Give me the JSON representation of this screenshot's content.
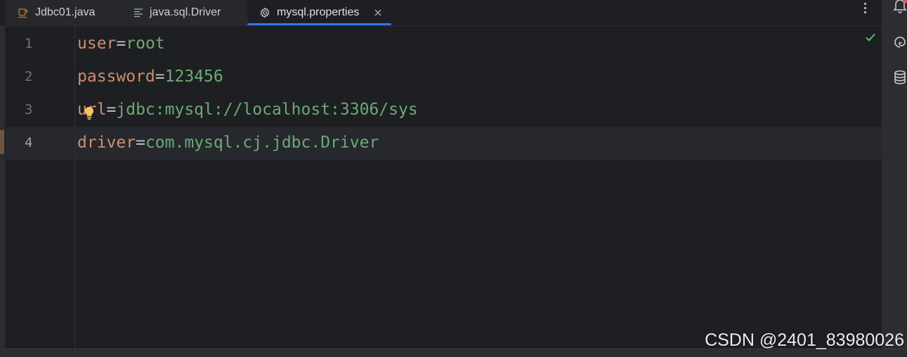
{
  "tabs": [
    {
      "label": "Jdbc01.java",
      "icon": "java-class-icon"
    },
    {
      "label": "java.sql.Driver",
      "icon": "text-file-icon"
    },
    {
      "label": "mysql.properties",
      "icon": "gear-icon",
      "active": true,
      "close_icon": "close-icon"
    }
  ],
  "toolbar": {
    "more_icon": "more-options-icon"
  },
  "right_bar": {
    "icons": [
      "bell-icon",
      "ai-assistant-icon",
      "database-icon"
    ]
  },
  "editor": {
    "status_icon": "check-icon",
    "current_line": 4,
    "lines": [
      {
        "number": "1",
        "key": "user",
        "sep": "=",
        "value": "root"
      },
      {
        "number": "2",
        "key": "password",
        "sep": "=",
        "value": "123456"
      },
      {
        "number": "3",
        "key": "url",
        "sep": "=",
        "value": "jdbc:mysql://localhost:3306/sys"
      },
      {
        "number": "4",
        "key": "driver",
        "sep": "=",
        "value": "com.mysql.cj.jdbc.Driver"
      }
    ],
    "intention_icon": "lightbulb-icon"
  },
  "watermark": "CSDN @2401_83980026",
  "colors": {
    "background": "#1e1f22",
    "accent": "#3574f0",
    "property_key": "#cf8e6d",
    "property_value": "#6aab73",
    "ok": "#5fb865",
    "lightbulb": "#f2c55c"
  }
}
